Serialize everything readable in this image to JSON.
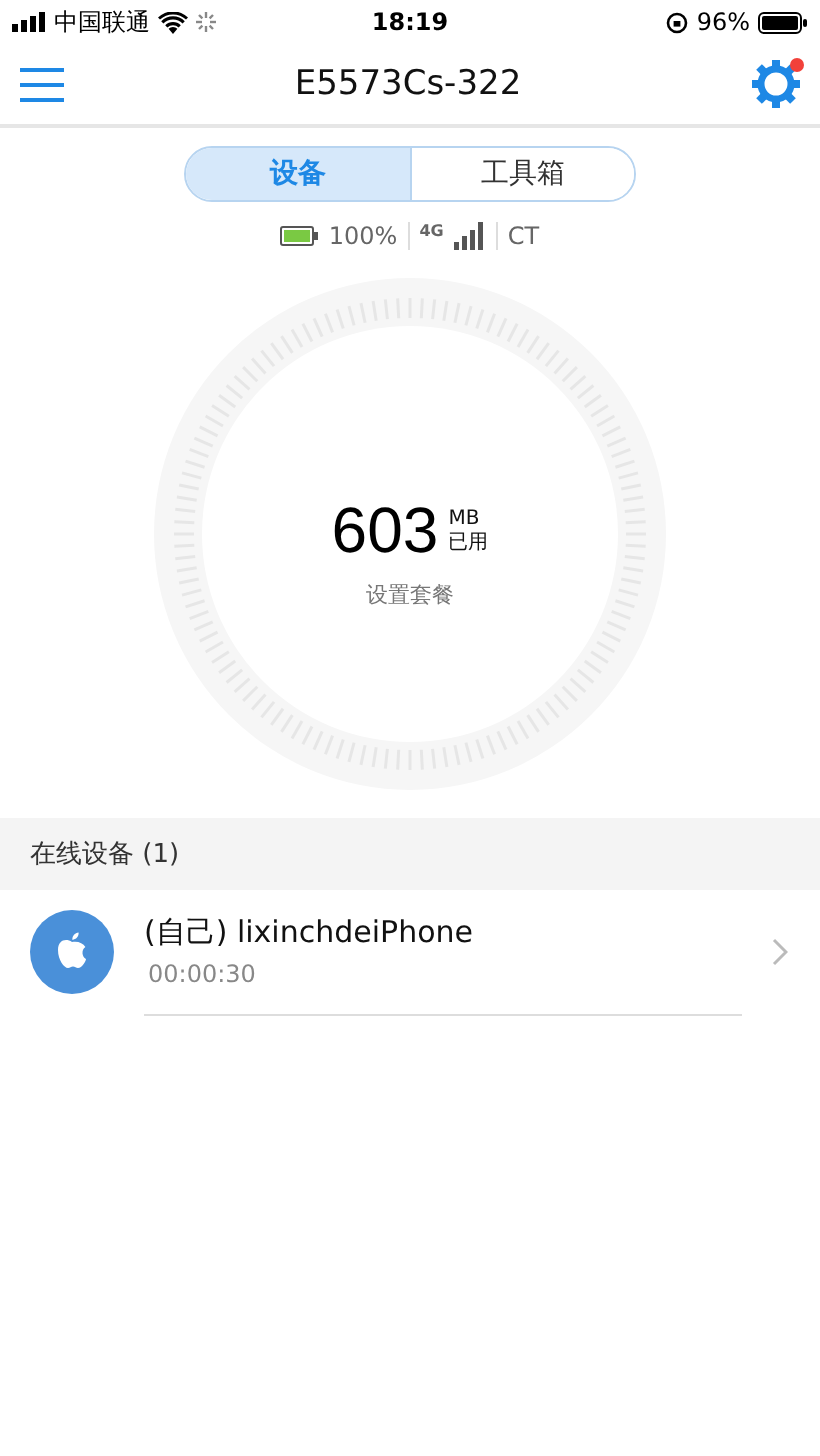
{
  "status_bar": {
    "carrier": "中国联通",
    "time": "18:19",
    "battery": "96%"
  },
  "nav": {
    "title": "E5573Cs-322",
    "settings_badge": true
  },
  "tabs": [
    {
      "label": "设备",
      "selected": true
    },
    {
      "label": "工具箱",
      "selected": false
    }
  ],
  "device_status": {
    "battery": "100%",
    "network": "4G",
    "operator": "CT"
  },
  "usage": {
    "amount": "603",
    "unit": "MB",
    "caption": "已用",
    "action": "设置套餐"
  },
  "online_devices": {
    "title": "在线设备 (1)",
    "items": [
      {
        "kind": "apple",
        "name": "(自己) lixinchdeiPhone",
        "duration": "00:00:30"
      }
    ]
  }
}
